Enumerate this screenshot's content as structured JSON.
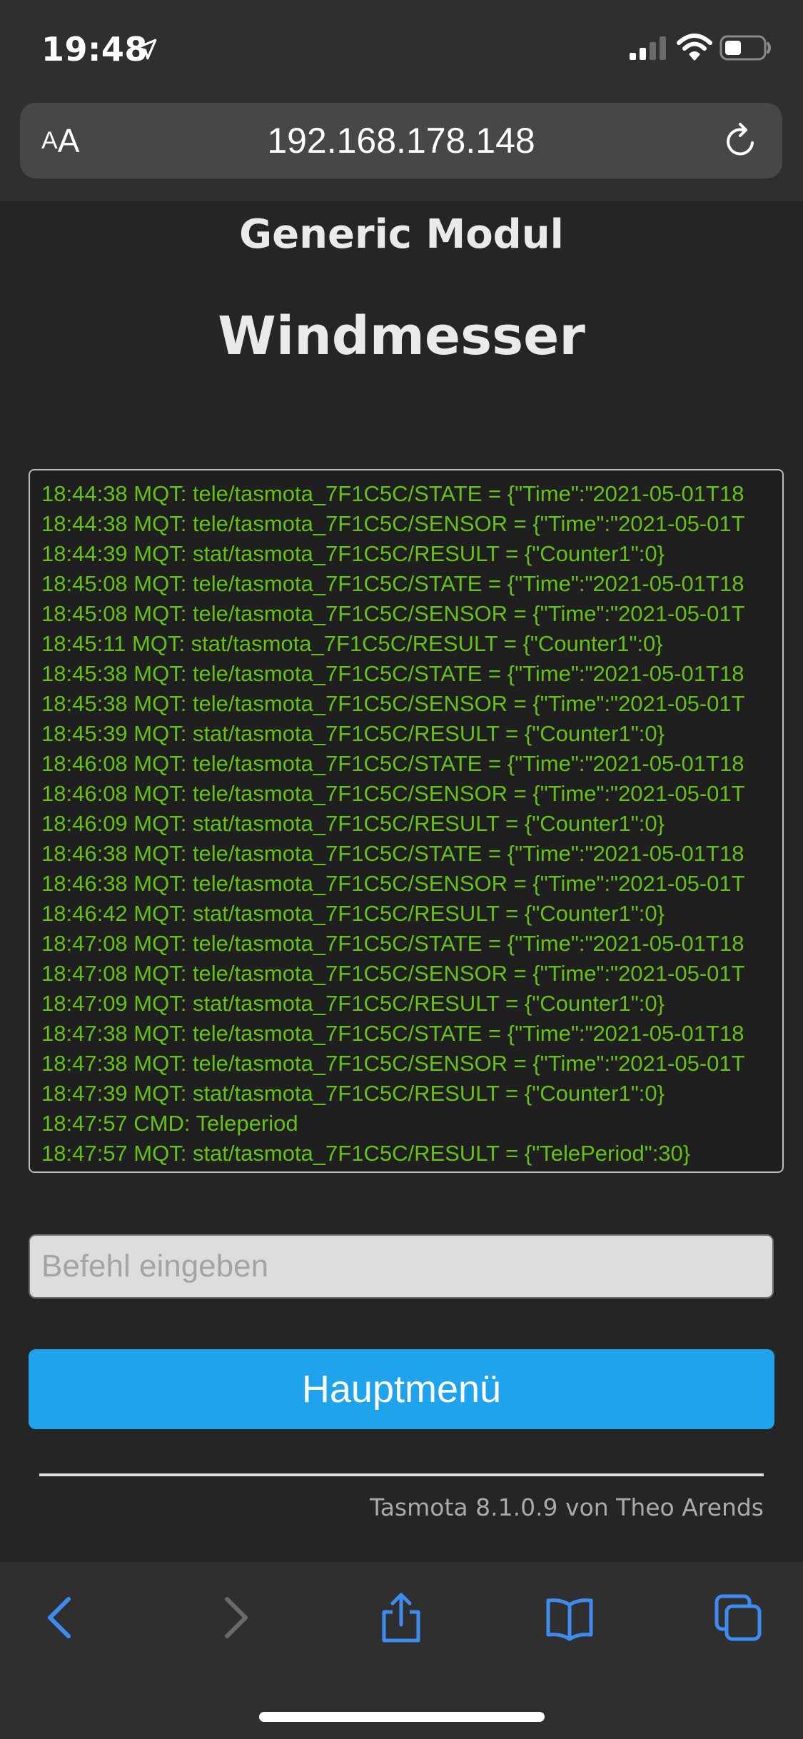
{
  "status_bar": {
    "time": "19:48",
    "icons": [
      "location-arrow-icon",
      "cellular-signal-icon",
      "wifi-icon",
      "battery-icon"
    ]
  },
  "browser": {
    "aa_small": "A",
    "aa_big": "A",
    "url": "192.168.178.148"
  },
  "page": {
    "module_title": "Generic Modul",
    "device_title": "Windmesser",
    "console_lines": [
      "18:44:38 MQT: tele/tasmota_7F1C5C/STATE = {\"Time\":\"2021-05-01T18",
      "18:44:38 MQT: tele/tasmota_7F1C5C/SENSOR = {\"Time\":\"2021-05-01T",
      "18:44:39 MQT: stat/tasmota_7F1C5C/RESULT = {\"Counter1\":0}",
      "18:45:08 MQT: tele/tasmota_7F1C5C/STATE = {\"Time\":\"2021-05-01T18",
      "18:45:08 MQT: tele/tasmota_7F1C5C/SENSOR = {\"Time\":\"2021-05-01T",
      "18:45:11 MQT: stat/tasmota_7F1C5C/RESULT = {\"Counter1\":0}",
      "18:45:38 MQT: tele/tasmota_7F1C5C/STATE = {\"Time\":\"2021-05-01T18",
      "18:45:38 MQT: tele/tasmota_7F1C5C/SENSOR = {\"Time\":\"2021-05-01T",
      "18:45:39 MQT: stat/tasmota_7F1C5C/RESULT = {\"Counter1\":0}",
      "18:46:08 MQT: tele/tasmota_7F1C5C/STATE = {\"Time\":\"2021-05-01T18",
      "18:46:08 MQT: tele/tasmota_7F1C5C/SENSOR = {\"Time\":\"2021-05-01T",
      "18:46:09 MQT: stat/tasmota_7F1C5C/RESULT = {\"Counter1\":0}",
      "18:46:38 MQT: tele/tasmota_7F1C5C/STATE = {\"Time\":\"2021-05-01T18",
      "18:46:38 MQT: tele/tasmota_7F1C5C/SENSOR = {\"Time\":\"2021-05-01T",
      "18:46:42 MQT: stat/tasmota_7F1C5C/RESULT = {\"Counter1\":0}",
      "18:47:08 MQT: tele/tasmota_7F1C5C/STATE = {\"Time\":\"2021-05-01T18",
      "18:47:08 MQT: tele/tasmota_7F1C5C/SENSOR = {\"Time\":\"2021-05-01T",
      "18:47:09 MQT: stat/tasmota_7F1C5C/RESULT = {\"Counter1\":0}",
      "18:47:38 MQT: tele/tasmota_7F1C5C/STATE = {\"Time\":\"2021-05-01T18",
      "18:47:38 MQT: tele/tasmota_7F1C5C/SENSOR = {\"Time\":\"2021-05-01T",
      "18:47:39 MQT: stat/tasmota_7F1C5C/RESULT = {\"Counter1\":0}",
      "18:47:57 CMD: Teleperiod",
      "18:47:57 MQT: stat/tasmota_7F1C5C/RESULT = {\"TelePeriod\":30}"
    ],
    "command_input": {
      "value": "",
      "placeholder": "Befehl eingeben"
    },
    "main_menu_label": "Hauptmenü",
    "footer": "Tasmota 8.1.0.9 von Theo Arends"
  },
  "toolbar": {
    "icons": [
      "back-icon",
      "forward-icon",
      "share-icon",
      "bookmarks-icon",
      "tabs-icon"
    ]
  },
  "colors": {
    "background": "#252525",
    "console_text": "#65c115",
    "button": "#1fa3ec",
    "ios_blue": "#3f8cf0"
  }
}
